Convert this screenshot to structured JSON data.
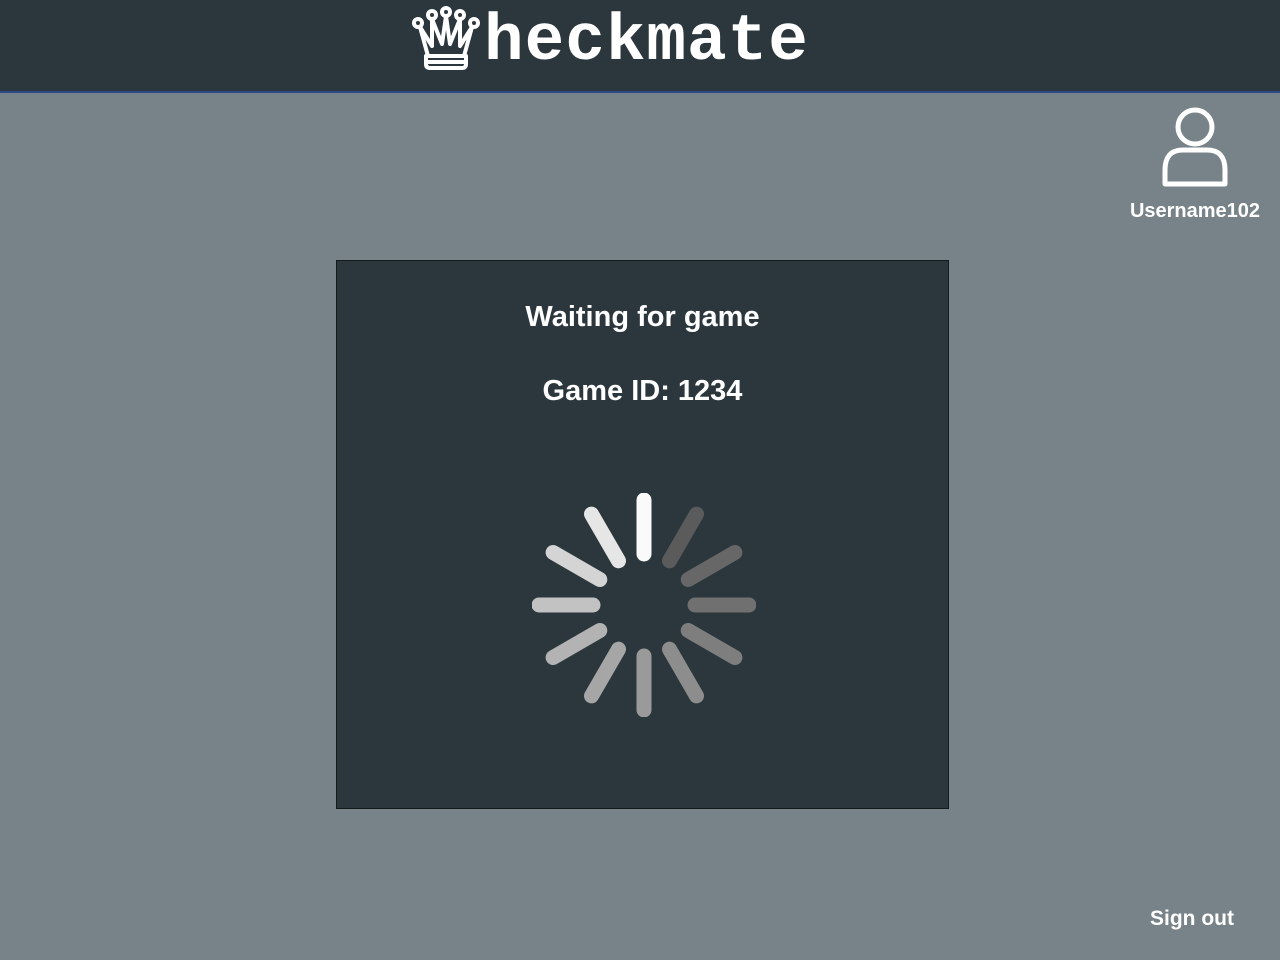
{
  "header": {
    "brand_text": "heckmate",
    "logo_icon": "queen-crown-icon"
  },
  "user": {
    "icon": "user-icon",
    "username": "Username102"
  },
  "waiting_panel": {
    "title": "Waiting for game",
    "game_id_text": "Game ID: 1234",
    "spinner_icon": "loading-spinner-icon"
  },
  "footer": {
    "signout_label": "Sign out"
  },
  "colors": {
    "background": "#778388",
    "panel": "#2b373c",
    "header": "#2b373c",
    "text": "#ffffff",
    "header_border": "#2e4a86"
  }
}
